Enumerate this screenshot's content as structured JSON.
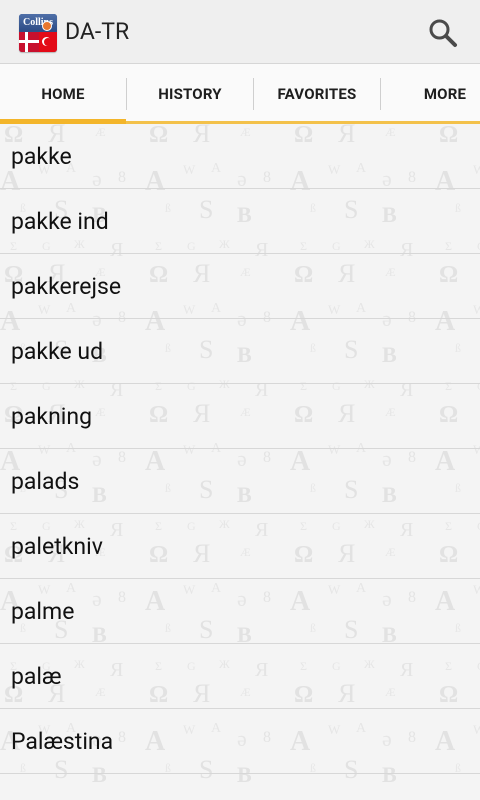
{
  "header": {
    "logo_text": "Collins",
    "title": "DA-TR",
    "search_icon": "search-icon"
  },
  "tabs": [
    {
      "label": "HOME",
      "selected": true
    },
    {
      "label": "HISTORY",
      "selected": false
    },
    {
      "label": "FAVORITES",
      "selected": false
    },
    {
      "label": "MORE",
      "selected": false
    }
  ],
  "list": {
    "items": [
      "pakke",
      "pakke ind",
      "pakkerejse",
      "pakke ud",
      "pakning",
      "palads",
      "paletkniv",
      "palme",
      "palæ",
      "Palæstina"
    ]
  },
  "colors": {
    "accent": "#f3b52a",
    "background": "#f4f4f4",
    "action_bar": "#efefef"
  }
}
